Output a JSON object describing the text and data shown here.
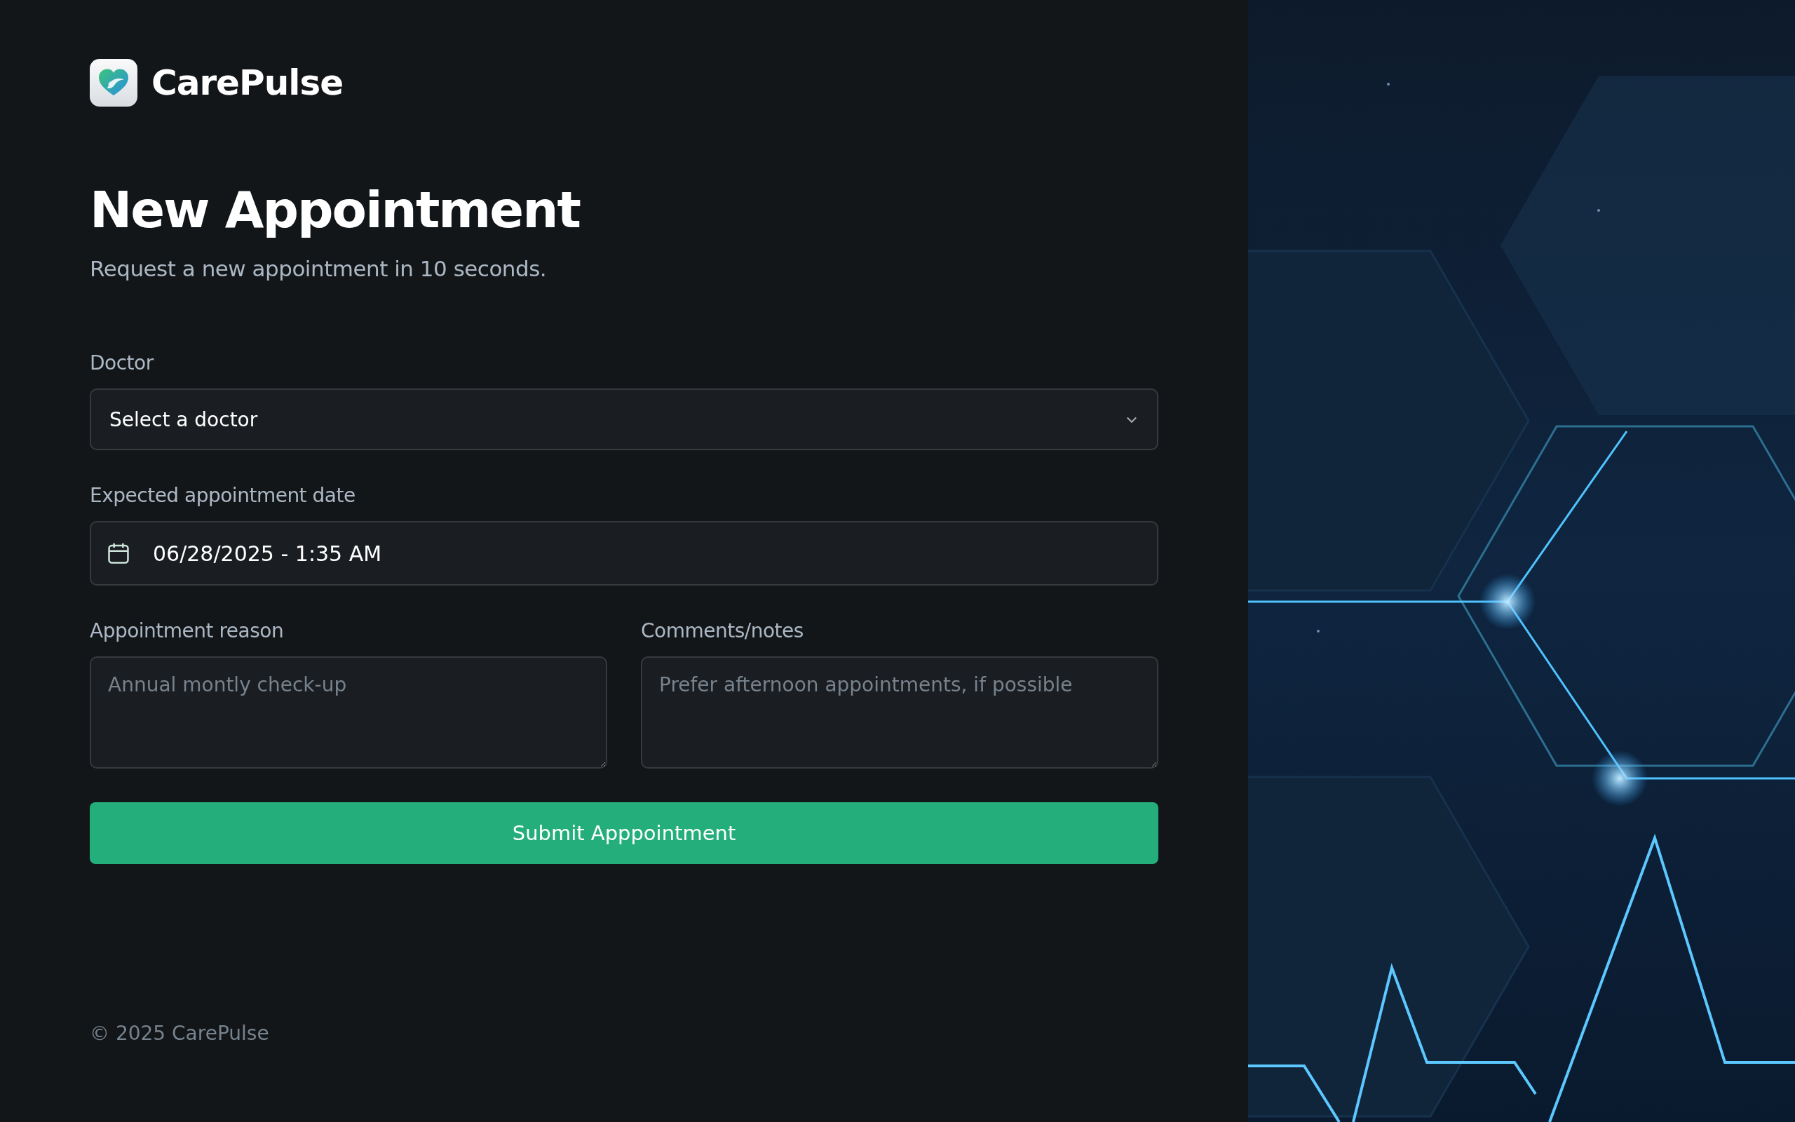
{
  "brand": {
    "name": "CarePulse"
  },
  "heading": {
    "title": "New Appointment",
    "subtitle": "Request a new appointment in 10 seconds."
  },
  "form": {
    "doctor": {
      "label": "Doctor",
      "placeholder": "Select a doctor"
    },
    "date": {
      "label": "Expected appointment date",
      "value": "06/28/2025 - 1:35 AM"
    },
    "notes": [
      {
        "label": "Appointment reason",
        "placeholder": "Annual montly check-up"
      },
      {
        "label": "Comments/notes",
        "placeholder": "Prefer afternoon appointments, if possible"
      }
    ],
    "submit": "Submit Apppointment"
  },
  "footer": {
    "copyright": "© 2025 CarePulse"
  }
}
